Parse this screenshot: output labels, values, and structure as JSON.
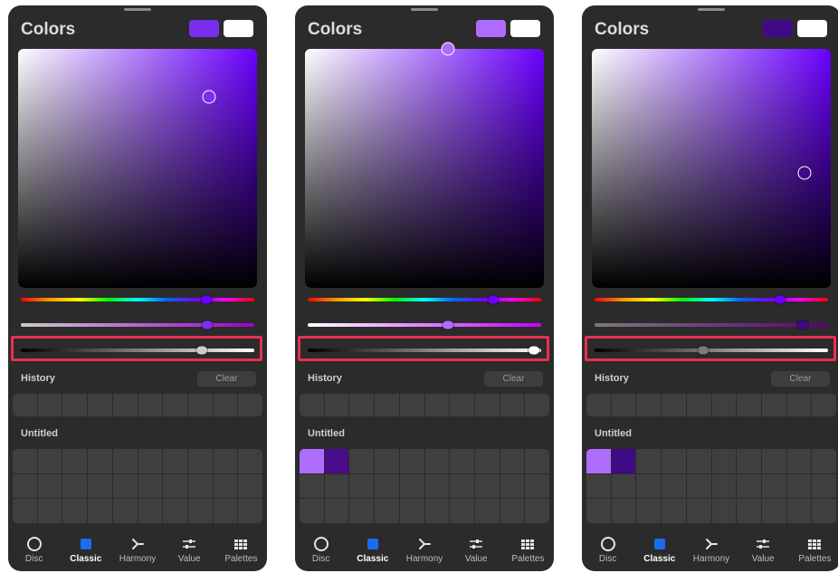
{
  "panels": [
    {
      "title": "Colors",
      "primary_color": "#7a2ff0",
      "secondary_color": "#ffffff",
      "hue_color": "#6a00ff",
      "hue": 0.795,
      "saturation": 0.8,
      "value": 0.8,
      "history_label": "History",
      "clear_label": "Clear",
      "palette_label": "Untitled",
      "palette_swatches": [],
      "highlighted_slider": "value-slider"
    },
    {
      "title": "Colors",
      "primary_color": "#ae6cff",
      "secondary_color": "#ffffff",
      "hue_color": "#6a00ff",
      "hue": 0.795,
      "saturation": 0.6,
      "value": 1.0,
      "history_label": "History",
      "clear_label": "Clear",
      "palette_label": "Untitled",
      "palette_swatches": [
        "#ae6cff",
        "#4b0c8c"
      ],
      "highlighted_slider": "value-slider"
    },
    {
      "title": "Colors",
      "primary_color": "#3f0a86",
      "secondary_color": "#ffffff",
      "hue_color": "#6a00ff",
      "hue": 0.795,
      "saturation": 0.89,
      "value": 0.48,
      "history_label": "History",
      "clear_label": "Clear",
      "palette_label": "Untitled",
      "palette_swatches": [
        "#ae6cff",
        "#3f0a86"
      ],
      "highlighted_slider": "value-slider"
    }
  ],
  "nav": [
    {
      "label": "Disc",
      "icon": "disc-icon",
      "active": false
    },
    {
      "label": "Classic",
      "icon": "classic-icon",
      "active": true
    },
    {
      "label": "Harmony",
      "icon": "harmony-icon",
      "active": false
    },
    {
      "label": "Value",
      "icon": "value-sliders-icon",
      "active": false
    },
    {
      "label": "Palettes",
      "icon": "palettes-grid-icon",
      "active": false
    }
  ],
  "colors": {
    "panel_bg": "#2b2b2b",
    "highlight": "#e8304d",
    "active_nav": "#1d6cf0"
  }
}
